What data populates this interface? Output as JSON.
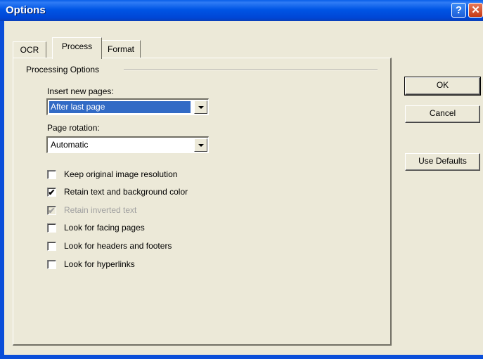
{
  "window": {
    "title": "Options",
    "help_icon": "?",
    "close_icon": "✕"
  },
  "tabs": [
    {
      "label": "OCR",
      "active": false
    },
    {
      "label": "Process",
      "active": true
    },
    {
      "label": "Format",
      "active": false
    }
  ],
  "group": {
    "label": "Processing Options"
  },
  "insert_pages": {
    "label": "Insert new pages:",
    "value": "After last page"
  },
  "page_rotation": {
    "label": "Page rotation:",
    "value": "Automatic"
  },
  "checkboxes": [
    {
      "label": "Keep original image resolution",
      "checked": false,
      "enabled": true,
      "mark": ""
    },
    {
      "label": "Retain text and background color",
      "checked": true,
      "enabled": true,
      "mark": "✔"
    },
    {
      "label": "Retain inverted text",
      "checked": true,
      "enabled": false,
      "mark": "✔"
    },
    {
      "label": "Look for facing pages",
      "checked": false,
      "enabled": true,
      "mark": ""
    },
    {
      "label": "Look for headers and footers",
      "checked": false,
      "enabled": true,
      "mark": ""
    },
    {
      "label": "Look for hyperlinks",
      "checked": false,
      "enabled": true,
      "mark": ""
    }
  ],
  "buttons": {
    "ok": "OK",
    "cancel": "Cancel",
    "defaults": "Use Defaults"
  },
  "colors": {
    "titlebar": "#0055e5",
    "face": "#ece9d8",
    "selection": "#316ac5"
  }
}
